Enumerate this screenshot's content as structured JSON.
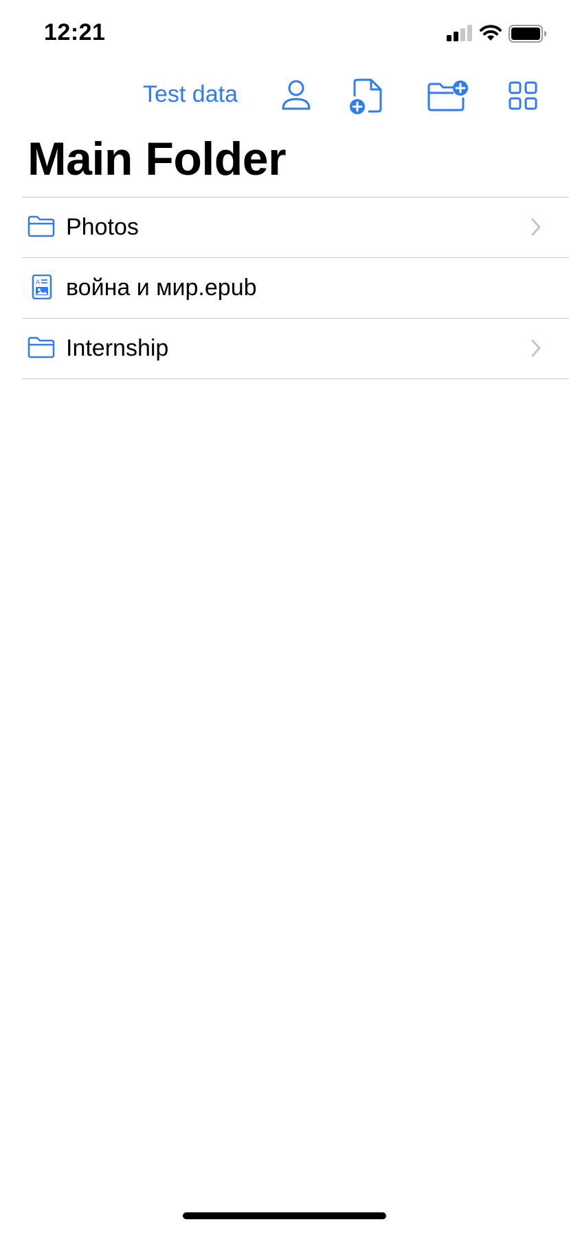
{
  "status_bar": {
    "time": "12:21"
  },
  "toolbar": {
    "test_data_label": "Test data",
    "icons": [
      "user-icon",
      "new-file-icon",
      "new-folder-icon",
      "grid-view-icon"
    ]
  },
  "title": "Main Folder",
  "items": [
    {
      "label": "Photos",
      "icon": "folder-icon",
      "type": "folder"
    },
    {
      "label": "война и мир.epub",
      "icon": "document-icon",
      "type": "file"
    },
    {
      "label": "Internship",
      "icon": "folder-icon",
      "type": "folder"
    }
  ],
  "colors": {
    "accent": "#2f7bf0",
    "separator": "#c8c8cc",
    "chevron": "#c4c4c7"
  }
}
